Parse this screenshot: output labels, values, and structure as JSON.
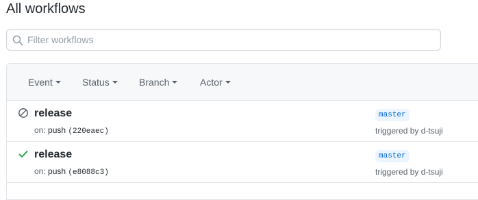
{
  "page": {
    "title": "All workflows"
  },
  "search": {
    "placeholder": "Filter workflows",
    "value": "",
    "icon": "search-icon"
  },
  "filters": [
    {
      "label": "Event"
    },
    {
      "label": "Status"
    },
    {
      "label": "Branch"
    },
    {
      "label": "Actor"
    }
  ],
  "runs": [
    {
      "title": "release",
      "status": "cancelled",
      "status_icon": "skip-icon",
      "on_label": "on:",
      "event": "push",
      "sha": "(220eaec)",
      "branch": "master",
      "triggered_by": "triggered by d-tsuji"
    },
    {
      "title": "release",
      "status": "success",
      "status_icon": "check-icon",
      "on_label": "on:",
      "event": "push",
      "sha": "(e8088c3)",
      "branch": "master",
      "triggered_by": "triggered by d-tsuji"
    }
  ],
  "colors": {
    "success": "#28a745",
    "neutral": "#586069",
    "link": "#0366d6",
    "branch_bg": "#eaf5ff"
  }
}
